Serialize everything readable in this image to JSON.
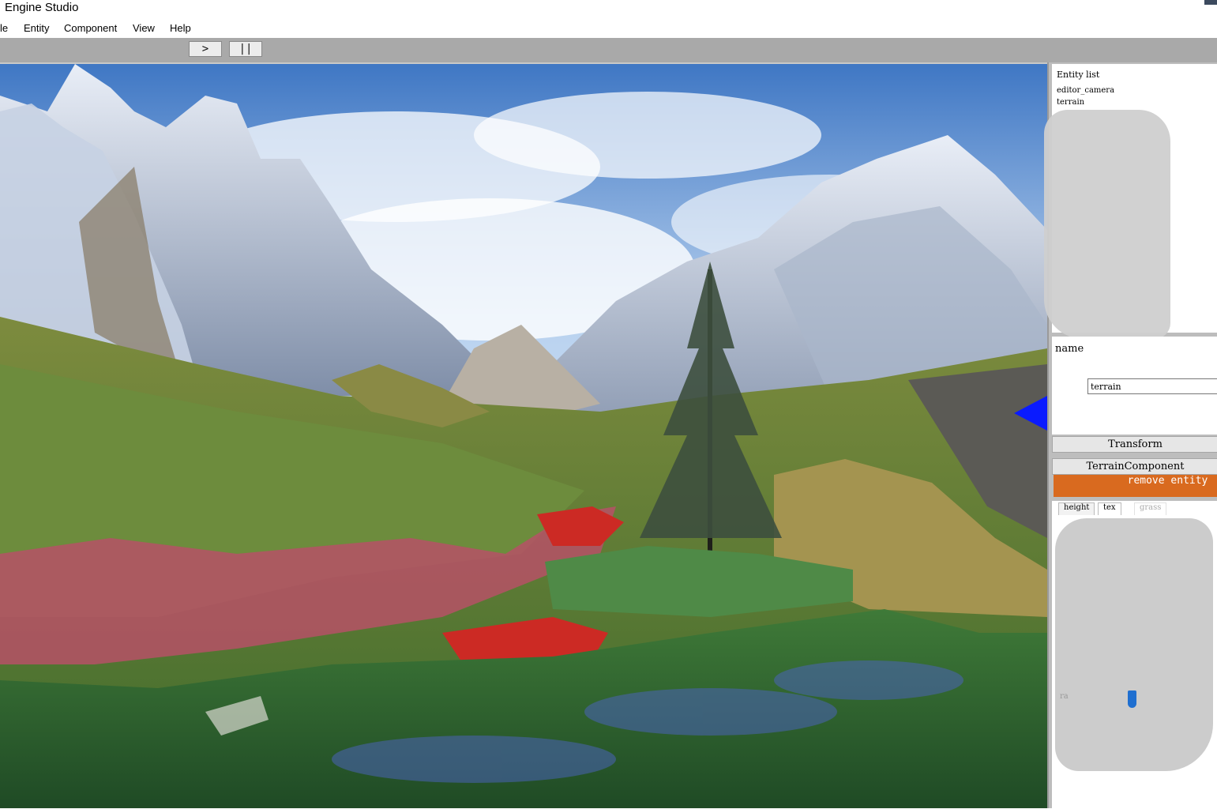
{
  "window": {
    "title": "Engine Studio"
  },
  "menu": {
    "items": [
      "le",
      "Entity",
      "Component",
      "View",
      "Help"
    ]
  },
  "toolbar": {
    "play_label": ">",
    "pause_label": "||"
  },
  "entity_list": {
    "header": "Entity list",
    "items": [
      "editor_camera",
      "terrain"
    ]
  },
  "properties": {
    "name_label": "name",
    "name_value": "terrain"
  },
  "components": {
    "transform_label": "Transform",
    "terrain_component_label": "TerrainComponent",
    "remove_entity_label": "remove entity"
  },
  "terrain_tabs": {
    "height": "height",
    "tex": "tex",
    "grass": "grass"
  },
  "slider": {
    "label": "ra"
  },
  "colors": {
    "toolbar_bg": "#a9a9a9",
    "panel_bg": "#bdbdbd",
    "remove_button": "#d96a1f",
    "gizmo_blue": "#0a1bff"
  }
}
